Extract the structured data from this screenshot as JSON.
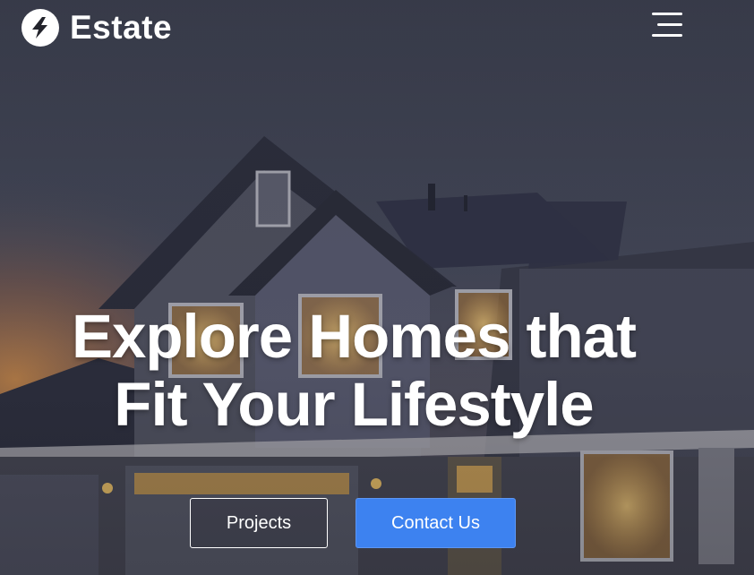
{
  "header": {
    "brand_name": "Estate",
    "logo_icon": "lightning-bolt-icon",
    "menu_icon": "hamburger-menu-icon"
  },
  "hero": {
    "headline_line1": "Explore Homes that",
    "headline_line2": "Fit Your Lifestyle",
    "background_image": "house-at-dusk-photo"
  },
  "actions": {
    "projects_label": "Projects",
    "contact_label": "Contact Us"
  },
  "colors": {
    "accent": "#3d82f0",
    "text": "#ffffff",
    "overlay": "#2c2f3c"
  }
}
